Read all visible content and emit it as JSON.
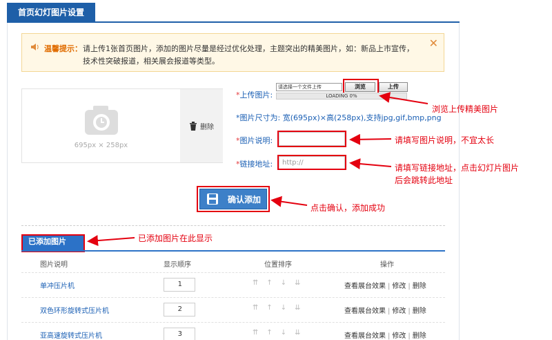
{
  "header": {
    "title": "首页幻灯图片设置"
  },
  "tip": {
    "label": "温馨提示：",
    "text": "请上传1张首页图片，添加的图片尽量是经过优化处理，主题突出的精美图片，如：新品上市宣传，技术性突破报道，相关展会报道等类型。",
    "close": "✕"
  },
  "image_preview": {
    "size_text": "695px × 258px",
    "delete_label": "删除"
  },
  "form": {
    "upload_label": "上传图片:",
    "upload_placeholder": "请选择一个文件上传",
    "browse_label": "浏览",
    "upload_button": "上传",
    "progress_text": "LOADING 0%",
    "size_info": "*图片尺寸为: 宽(695px)×高(258px),支持jpg,gif,bmp,png",
    "desc_label": "图片说明:",
    "desc_value": "",
    "link_label": "链接地址:",
    "link_placeholder": "http://",
    "confirm_label": "确认添加"
  },
  "annotations": {
    "browse": "浏览上传精美图片",
    "desc": "请填写图片说明，不宜太长",
    "link_line1": "请填写链接地址，点击幻灯片图片",
    "link_line2": "后会跳转此地址",
    "confirm": "点击确认，添加成功",
    "added": "已添加图片在此显示"
  },
  "added_section": {
    "title": "已添加图片",
    "columns": [
      "图片说明",
      "显示顺序",
      "位置排序",
      "操作"
    ],
    "rows": [
      {
        "name": "单冲压片机",
        "order": "1"
      },
      {
        "name": "双色环形旋转式压片机",
        "order": "2"
      },
      {
        "name": "亚高速旋转式压片机",
        "order": "3"
      }
    ],
    "actions": {
      "view": "查看展台效果",
      "edit": "修改",
      "delete": "删除"
    },
    "sort_arrows": "⇈↑↓⇊"
  },
  "colors": {
    "accent": "#1e5fa8",
    "annotation": "#e4000f",
    "tip_bg": "#fff8e6"
  }
}
